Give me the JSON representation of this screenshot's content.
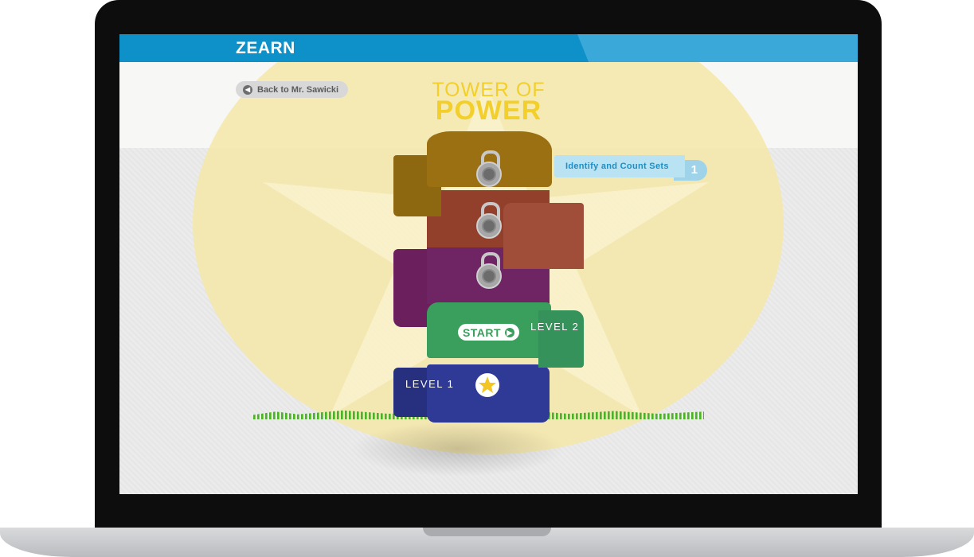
{
  "app": {
    "logo": "ZEARN"
  },
  "nav": {
    "back_label": "Back to Mr. Sawicki"
  },
  "game": {
    "title_line_1": "TOWER OF",
    "title_line_2": "POWER",
    "mission_label": "Identify and Count Sets",
    "mission_number": "1",
    "levels": [
      {
        "label": "LEVEL 1",
        "status": "completed"
      },
      {
        "label": "LEVEL 2",
        "status": "current",
        "action": "START"
      },
      {
        "status": "locked"
      },
      {
        "status": "locked"
      },
      {
        "status": "locked"
      }
    ]
  },
  "colors": {
    "brand_blue": "#0d91c8",
    "title_yellow": "#f2cf2a",
    "level_1": "#2f3a97",
    "level_2": "#3a9e5d",
    "level_3": "#6b1f5c",
    "level_4": "#92402c",
    "level_5": "#9a7013"
  },
  "icons": {
    "back": "arrow-left-circle",
    "start": "arrow-right-circle",
    "completed": "star",
    "locked": "combination-lock"
  }
}
